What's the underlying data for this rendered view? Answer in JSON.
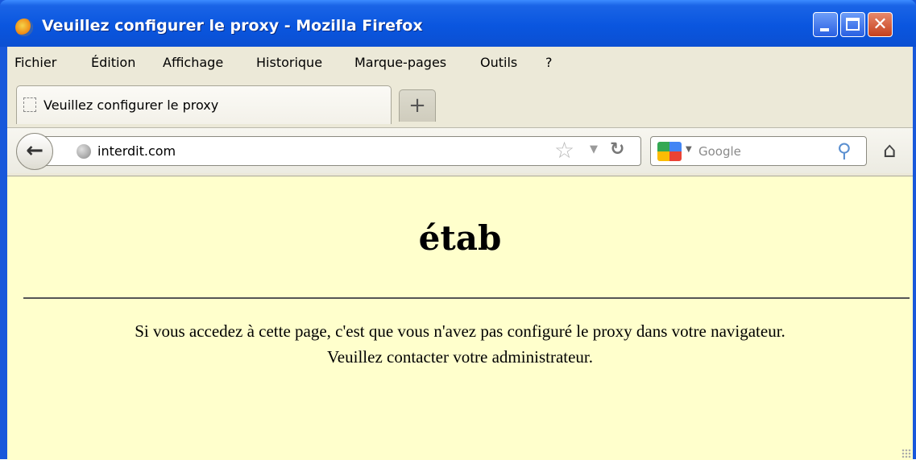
{
  "window": {
    "title": "Veuillez configurer le proxy - Mozilla Firefox",
    "controls": {
      "close_glyph": "✕"
    }
  },
  "menu": {
    "items": [
      {
        "label": "Fichier"
      },
      {
        "label": "Édition"
      },
      {
        "label": "Affichage"
      },
      {
        "label": "Historique"
      },
      {
        "label": "Marque-pages"
      },
      {
        "label": "Outils"
      },
      {
        "label": "?"
      }
    ]
  },
  "tabs": [
    {
      "label": "Veuillez configurer le proxy",
      "active": true
    }
  ],
  "newtab_label": "+",
  "navbar": {
    "url": "interdit.com",
    "search_placeholder": "Google",
    "icons": {
      "back": "back-arrow-icon",
      "site": "globe-icon",
      "bookmark": "star-icon",
      "history_dropdown": "dropdown-icon",
      "reload": "reload-icon",
      "search_engine": "google-icon",
      "search": "magnifier-icon",
      "home": "home-icon"
    }
  },
  "page": {
    "heading": "étab",
    "message_line1": "Si vous accedez à cette page, c'est que vous n'avez pas configuré le proxy dans votre navigateur.",
    "message_line2": "Veuillez contacter votre administrateur."
  },
  "colors": {
    "titlebar": "#0a56df",
    "content_background": "#ffffcc",
    "chrome_background": "#ece9d8"
  }
}
